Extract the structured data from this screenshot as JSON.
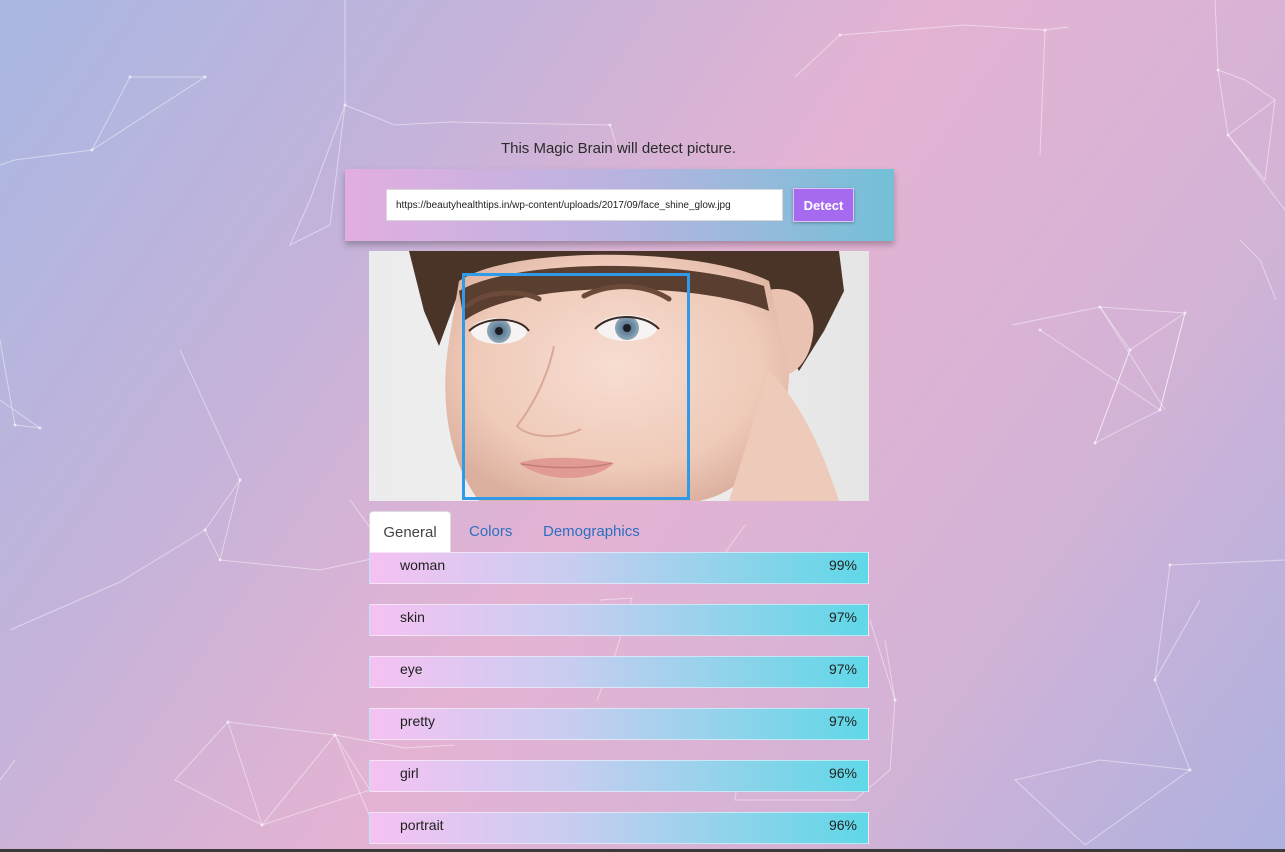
{
  "intro": {
    "text": "This Magic Brain will detect picture."
  },
  "form": {
    "url_value": "https://beautyhealthtips.in/wp-content/uploads/2017/09/face_shine_glow.jpg",
    "detect_label": "Detect"
  },
  "colors": {
    "detect_button": "#a56af0",
    "face_box": "#2e9ae8",
    "tab_link": "#2d6fc0"
  },
  "tabs": [
    {
      "label": "General",
      "active": true
    },
    {
      "label": "Colors",
      "active": false
    },
    {
      "label": "Demographics",
      "active": false
    }
  ],
  "concepts": [
    {
      "name": "woman",
      "value": "99%"
    },
    {
      "name": "skin",
      "value": "97%"
    },
    {
      "name": "eye",
      "value": "97%"
    },
    {
      "name": "pretty",
      "value": "97%"
    },
    {
      "name": "girl",
      "value": "96%"
    },
    {
      "name": "portrait",
      "value": "96%"
    }
  ]
}
